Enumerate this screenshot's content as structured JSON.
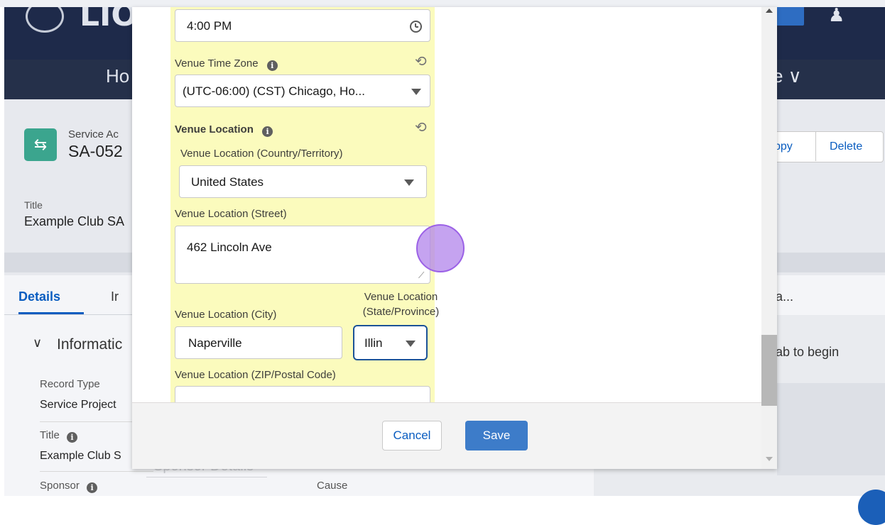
{
  "background": {
    "header": {
      "logo_text": "LIO",
      "nav_home": "Ho",
      "nav_right": "e ∨"
    },
    "record": {
      "type_label": "Service Ac",
      "name": "SA-052",
      "copy_button": "ppy",
      "delete_button": "Delete",
      "highlight_title_label": "Title",
      "highlight_title_value": "Example Club SA"
    },
    "tabs": {
      "details": "Details",
      "info": "Ir",
      "right": "a..."
    },
    "section": {
      "chevron": "∨",
      "title": "Informatic",
      "record_type_label": "Record Type",
      "record_type_value": "Service Project",
      "title_label": "Title",
      "title_value": "Example Club S",
      "sponsor_label": "Sponsor",
      "cause_label": "Cause",
      "right_text": "ab to begin",
      "sponsor_details": "Sponsor Details"
    }
  },
  "modal": {
    "time_value": "4:00 PM",
    "time_zone": {
      "label": "Venue Time Zone",
      "value": "(UTC-06:00) (CST) Chicago, Ho..."
    },
    "venue_location": {
      "section_label": "Venue Location",
      "country_label": "Venue Location (Country/Territory)",
      "country_value": "United States",
      "street_label": "Venue Location (Street)",
      "street_value": "462 Lincoln Ave",
      "city_label": "Venue Location (City)",
      "city_value": "Naperville",
      "state_label_line1": "Venue Location",
      "state_label_line2": "(State/Province)",
      "state_value": "Illin",
      "zip_label": "Venue Location (ZIP/Postal Code)",
      "zip_value": ""
    },
    "footer": {
      "cancel_label": "Cancel",
      "save_label": "Save"
    }
  },
  "icons": {
    "info": "i",
    "undo": "⟲",
    "resize": "⟋"
  },
  "colors": {
    "highlight_yellow": "#fbfbbd",
    "brand_blue": "#0a5dc0",
    "save_blue": "#3d7cc9",
    "header_navy": "#25304a",
    "record_icon_green": "#3ba58e",
    "cursor_purple": "#b284eb"
  }
}
